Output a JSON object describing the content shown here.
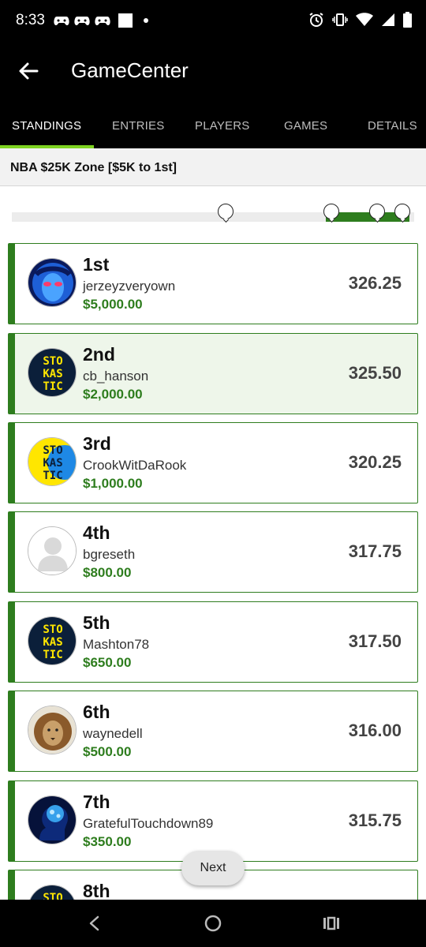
{
  "status_bar": {
    "time": "8:33",
    "icons": [
      "game-controller-icon",
      "game-controller-icon",
      "game-controller-icon",
      "notification-square-icon",
      "dot-icon",
      "alarm-icon",
      "vibrate-icon",
      "wifi-icon",
      "signal-icon",
      "battery-icon"
    ]
  },
  "app_bar": {
    "title": "GameCenter",
    "back_icon": "arrow-left-icon"
  },
  "tabs": [
    {
      "label": "STANDINGS",
      "active": true
    },
    {
      "label": "ENTRIES",
      "active": false
    },
    {
      "label": "PLAYERS",
      "active": false
    },
    {
      "label": "GAMES",
      "active": false
    },
    {
      "label": "DETAILS",
      "active": false
    }
  ],
  "contest": {
    "name": "NBA $25K Zone [$5K to 1st]"
  },
  "colors": {
    "accent_green": "#2e7d1e",
    "tab_indicator": "#7ed321",
    "stokastic_yellow": "#ffe600",
    "stokastic_navy": "#0b1f3a"
  },
  "standings": [
    {
      "rank": "1st",
      "username": "jerzeyzveryown",
      "prize": "$5,000.00",
      "score": "326.25",
      "avatar": "blue-alien-avatar",
      "highlight": false
    },
    {
      "rank": "2nd",
      "username": "cb_hanson",
      "prize": "$2,000.00",
      "score": "325.50",
      "avatar": "stokastic-logo-avatar",
      "highlight": true
    },
    {
      "rank": "3rd",
      "username": "CrookWitDaRook",
      "prize": "$1,000.00",
      "score": "320.25",
      "avatar": "stokastic-logo-yellow-avatar",
      "highlight": false
    },
    {
      "rank": "4th",
      "username": "bgreseth",
      "prize": "$800.00",
      "score": "317.75",
      "avatar": "default-person-avatar",
      "highlight": false
    },
    {
      "rank": "5th",
      "username": "Mashton78",
      "prize": "$650.00",
      "score": "317.50",
      "avatar": "stokastic-logo-avatar",
      "highlight": false
    },
    {
      "rank": "6th",
      "username": "waynedell",
      "prize": "$500.00",
      "score": "316.00",
      "avatar": "lion-avatar",
      "highlight": false
    },
    {
      "rank": "7th",
      "username": "GratefulTouchdown89",
      "prize": "$350.00",
      "score": "315.75",
      "avatar": "brain-head-avatar",
      "highlight": false
    },
    {
      "rank": "8th",
      "username": "",
      "prize": "",
      "score": "",
      "avatar": "stokastic-logo-avatar",
      "highlight": false
    }
  ],
  "logo_text": {
    "line1": "STO",
    "line2": "KAS",
    "line3": "TIC"
  },
  "next_button": {
    "label": "Next"
  },
  "nav_bar": {
    "icons": [
      "back-triangle-icon",
      "home-circle-icon",
      "recents-icon"
    ]
  }
}
